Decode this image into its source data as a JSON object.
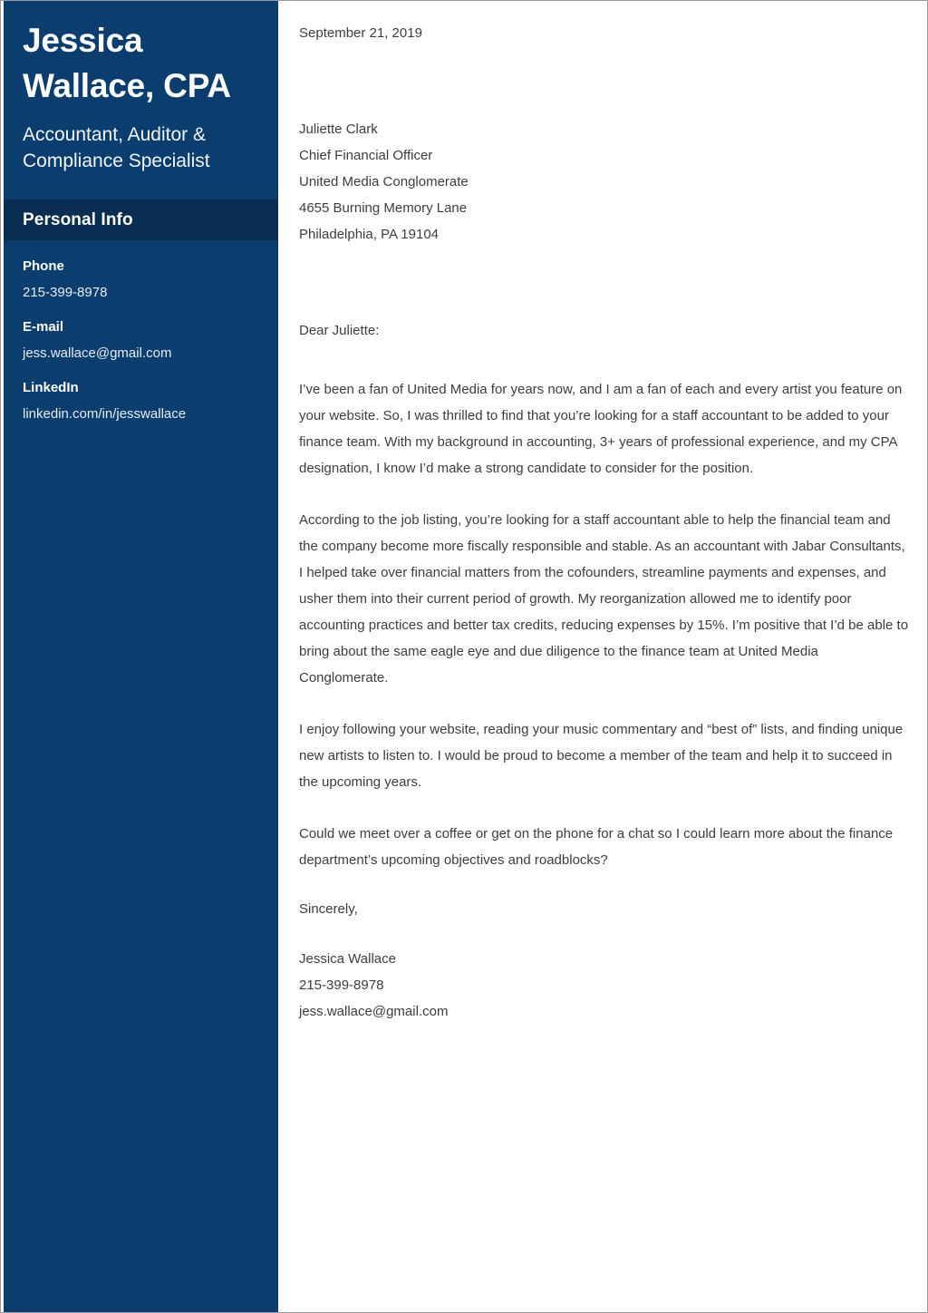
{
  "sidebar": {
    "name": "Jessica Wallace, CPA",
    "title": "Accountant, Auditor & Compliance Specialist",
    "section_heading": "Personal Info",
    "contacts": [
      {
        "label": "Phone",
        "value": "215-399-8978"
      },
      {
        "label": "E-mail",
        "value": "jess.wallace@gmail.com"
      },
      {
        "label": "LinkedIn",
        "value": "linkedin.com/in/jesswallace"
      }
    ]
  },
  "letter": {
    "date": "September 21, 2019",
    "recipient": [
      "Juliette Clark",
      "Chief Financial Officer",
      "United Media Conglomerate",
      "4655 Burning Memory Lane",
      "Philadelphia, PA 19104"
    ],
    "salutation": "Dear Juliette:",
    "paragraphs": [
      "I’ve been a fan of United Media for years now, and I am a fan of each and every artist you feature on your website. So, I was thrilled to find that you’re looking for a staff accountant to be added to your finance team. With my background in accounting, 3+ years of professional experience, and my CPA designation, I know I’d make a strong candidate to consider for the position.",
      "According to the job listing, you’re looking for a staff accountant able to help the financial team and the company become more fiscally responsible and stable. As an accountant with Jabar Consultants, I helped take over financial matters from the cofounders, streamline payments and expenses, and usher them into their current period of growth. My reorganization allowed me to identify poor accounting practices and better tax credits, reducing expenses by 15%. I’m positive that I’d be able to bring about the same eagle eye and due diligence to the finance team at United Media Conglomerate.",
      "I enjoy following your website, reading your music commentary and “best of” lists, and finding unique new artists to listen to. I would be proud to become a member of the team and help it to succeed in the upcoming years.",
      "Could we meet over a coffee or get on the phone for a chat so I could learn more about the finance department’s upcoming objectives and roadblocks?"
    ],
    "closing": "Sincerely,",
    "signature": [
      "Jessica Wallace",
      "215-399-8978",
      "jess.wallace@gmail.com"
    ]
  },
  "colors": {
    "sidebar_background": "#0b3d6e",
    "section_band_background": "#0a2d52",
    "body_text": "#3d3d3d",
    "sidebar_text": "#ffffff"
  }
}
